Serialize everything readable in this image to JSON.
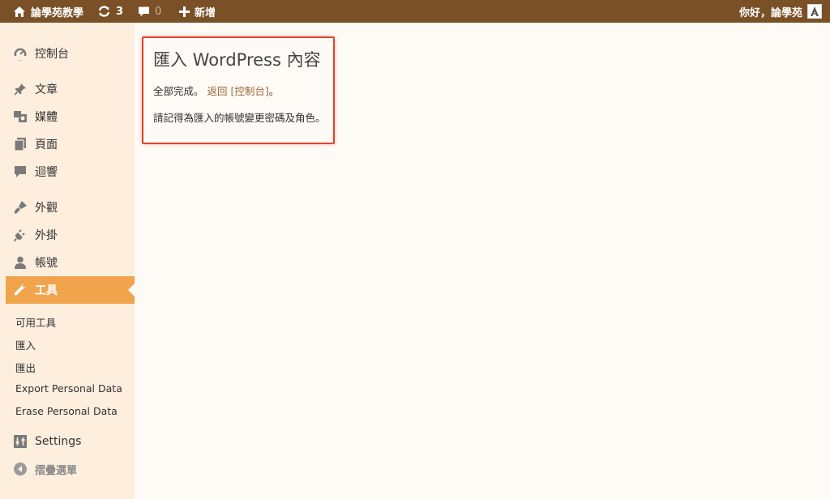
{
  "adminbar": {
    "site_name": "論學苑教學",
    "updates_count": "3",
    "comments_count": "0",
    "new_label": "新增",
    "greeting": "你好，論學苑"
  },
  "sidebar": {
    "items": [
      {
        "label": "控制台",
        "icon": "dashboard-icon"
      },
      {
        "label": "文章",
        "icon": "pin-icon"
      },
      {
        "label": "媒體",
        "icon": "media-icon"
      },
      {
        "label": "頁面",
        "icon": "page-icon"
      },
      {
        "label": "迴響",
        "icon": "comment-icon"
      },
      {
        "label": "外觀",
        "icon": "brush-icon"
      },
      {
        "label": "外掛",
        "icon": "plugin-icon"
      },
      {
        "label": "帳號",
        "icon": "user-icon"
      },
      {
        "label": "工具",
        "icon": "wrench-icon"
      },
      {
        "label": "Settings",
        "icon": "settings-icon"
      },
      {
        "label": "摺疊選單",
        "icon": "collapse-icon"
      }
    ],
    "submenu": [
      "可用工具",
      "匯入",
      "匯出",
      "Export Personal Data",
      "Erase Personal Data"
    ]
  },
  "main": {
    "title": "匯入 WordPress 內容",
    "done_text": "全部完成。",
    "back_link": "返回 [控制台]",
    "period": "。",
    "reminder": "請記得為匯入的帳號變更密碼及角色。"
  },
  "colors": {
    "adminbar": "#7a5126",
    "sidebar": "#fdeedd",
    "active": "#f1a44c",
    "link": "#9c6a36",
    "highlight_border": "#e0432e"
  }
}
